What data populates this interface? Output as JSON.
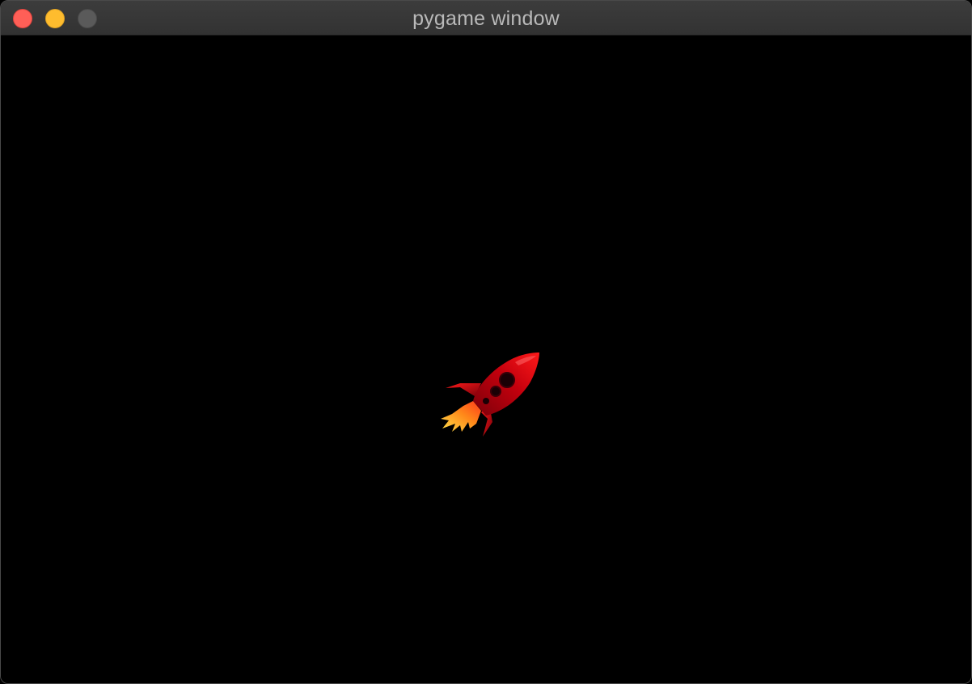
{
  "window": {
    "title": "pygame window",
    "controls": {
      "close_color": "#ff5f57",
      "minimize_color": "#febc2e",
      "zoom_color": "#5a5a5a"
    }
  },
  "game": {
    "background_color": "#000000",
    "sprite": {
      "name": "rocket",
      "icon": "rocket-icon",
      "body_color": "#e3000f",
      "flame_color": "#ff8a1a"
    }
  }
}
